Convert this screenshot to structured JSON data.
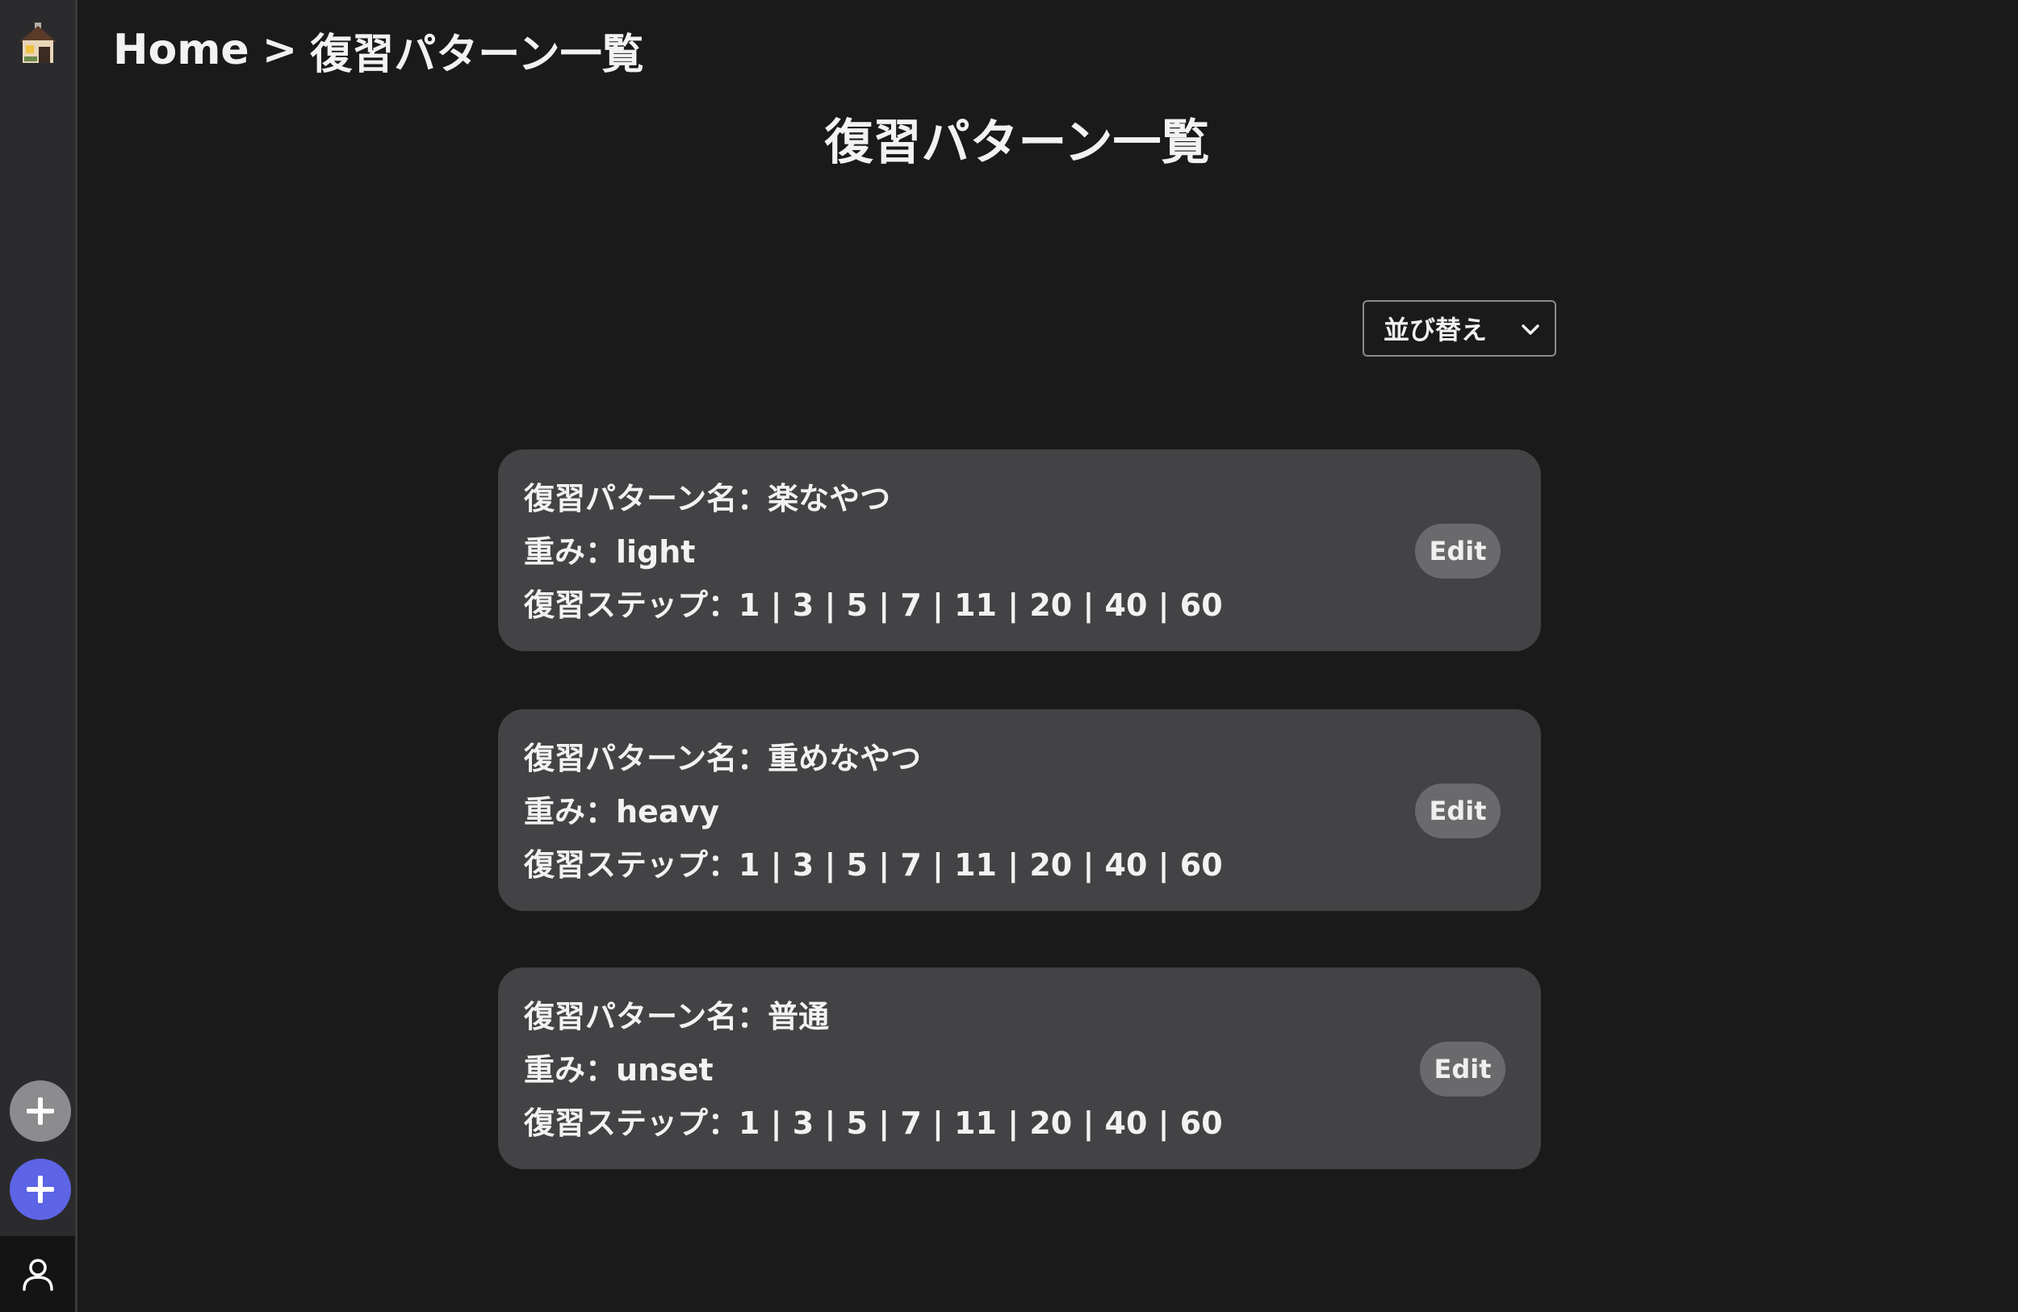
{
  "breadcrumb": {
    "home": "Home",
    "separator": ">",
    "current": "復習パターン一覧"
  },
  "page": {
    "title": "復習パターン一覧"
  },
  "sort": {
    "label": "並び替え"
  },
  "patterns": [
    {
      "name_line": "復習パターン名：楽なやつ",
      "weight_line": "重み：light",
      "steps_line": "復習ステップ：1 | 3 | 5 | 7 | 11 | 20 | 40 | 60",
      "edit_label": "Edit"
    },
    {
      "name_line": "復習パターン名：重めなやつ",
      "weight_line": "重み：heavy",
      "steps_line": "復習ステップ：1 | 3 | 5 | 7 | 11 | 20 | 40 | 60",
      "edit_label": "Edit"
    },
    {
      "name_line": "復習パターン名：普通",
      "weight_line": "重み：unset",
      "steps_line": "復習ステップ：1 | 3 | 5 | 7 | 11 | 20 | 40 | 60",
      "edit_label": "Edit"
    }
  ],
  "icons": {
    "home": "house-icon",
    "add_gray": "plus-icon",
    "add_blue": "plus-icon",
    "user": "user-icon",
    "sort": "chevron-down-icon"
  },
  "colors": {
    "background": "#1a1a1b",
    "sidebar": "#2b2b2d",
    "card": "#434345",
    "edit_button": "#6a6a6c",
    "accent_blue": "#5d64e6",
    "fab_gray": "#8c8c8f"
  }
}
